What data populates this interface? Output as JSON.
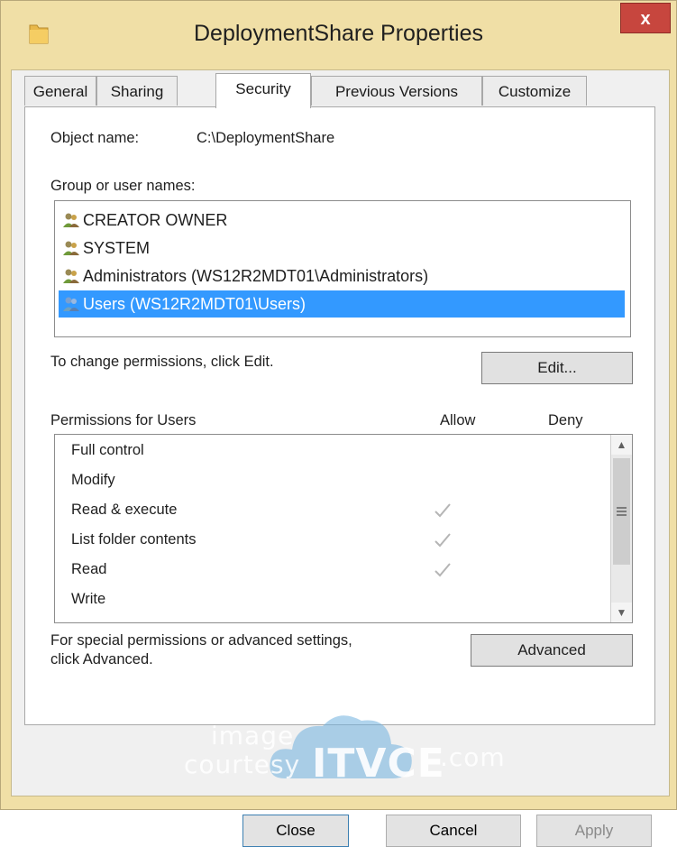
{
  "window": {
    "title": "DeploymentShare Properties",
    "close_label": "x"
  },
  "tabs": [
    {
      "label": "General"
    },
    {
      "label": "Sharing"
    },
    {
      "label": "Security"
    },
    {
      "label": "Previous Versions"
    },
    {
      "label": "Customize"
    }
  ],
  "active_tab": "Security",
  "object": {
    "label": "Object name:",
    "value": "C:\\DeploymentShare"
  },
  "groups": {
    "label": "Group or user names:",
    "items": [
      {
        "name": "CREATOR OWNER",
        "icon": "users-group-icon"
      },
      {
        "name": "SYSTEM",
        "icon": "users-group-icon"
      },
      {
        "name": "Administrators (WS12R2MDT01\\Administrators)",
        "icon": "users-group-icon"
      },
      {
        "name": "Users (WS12R2MDT01\\Users)",
        "icon": "users-group-icon"
      }
    ],
    "selected_index": 3
  },
  "change_text": "To change permissions, click Edit.",
  "edit_button": "Edit...",
  "permissions": {
    "header": "Permissions for Users",
    "allow_label": "Allow",
    "deny_label": "Deny",
    "items": [
      {
        "name": "Full control",
        "allow": false,
        "deny": false
      },
      {
        "name": "Modify",
        "allow": false,
        "deny": false
      },
      {
        "name": "Read & execute",
        "allow": true,
        "deny": false
      },
      {
        "name": "List folder contents",
        "allow": true,
        "deny": false
      },
      {
        "name": "Read",
        "allow": true,
        "deny": false
      },
      {
        "name": "Write",
        "allow": false,
        "deny": false
      }
    ]
  },
  "advanced": {
    "text_line1": "For special permissions or advanced settings,",
    "text_line2": "click Advanced.",
    "button": "Advanced"
  },
  "footer": {
    "close": "Close",
    "cancel": "Cancel",
    "apply": "Apply"
  },
  "watermark": {
    "line1": "image",
    "line2": "courtesy",
    "brand": "ITVCE",
    "suffix": ".com"
  },
  "colors": {
    "selection": "#3399ff",
    "close_button": "#c7463e",
    "frame": "#f0dfa6"
  }
}
